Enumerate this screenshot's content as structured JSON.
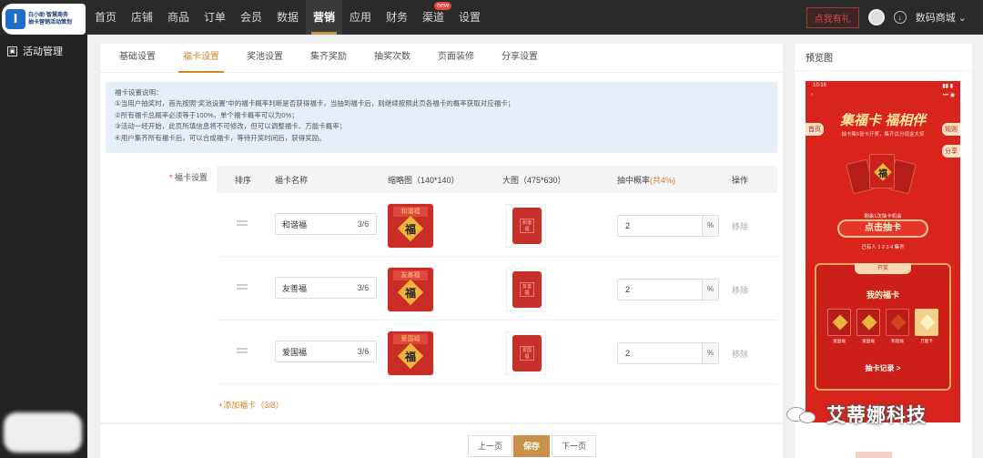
{
  "app": {
    "logo_text_line1": "白小助·智慧商务",
    "logo_text_line2": "抽卡营销活动策划",
    "logo_glyph": "Ⅰ",
    "accent_color": "#c8904a"
  },
  "topnav": {
    "items": [
      {
        "label": "首页"
      },
      {
        "label": "店铺"
      },
      {
        "label": "商品"
      },
      {
        "label": "订单"
      },
      {
        "label": "会员"
      },
      {
        "label": "数据"
      },
      {
        "label": "营销",
        "active": true
      },
      {
        "label": "应用"
      },
      {
        "label": "财务"
      },
      {
        "label": "渠道",
        "badge": "new"
      },
      {
        "label": "设置"
      }
    ],
    "gift_button": "点我有礼",
    "store_name": "数码商城",
    "store_chevron": "⌄",
    "download_glyph": "↓"
  },
  "sidebar": {
    "item_label": "活动管理",
    "item_icon": "▣"
  },
  "tabs": [
    {
      "label": "基础设置"
    },
    {
      "label": "福卡设置",
      "active": true
    },
    {
      "label": "奖池设置"
    },
    {
      "label": "集齐奖励"
    },
    {
      "label": "抽奖次数"
    },
    {
      "label": "页面装修"
    },
    {
      "label": "分享设置"
    }
  ],
  "notice": {
    "lines": [
      "福卡设置说明：",
      "①当用户抽奖时，首先按照“奖池设置”中的福卡概率判断是否获得福卡，当抽到福卡后，则继续按照此页各福卡的概率获取对应福卡；",
      "②所有福卡总概率必须等于100%，单个福卡概率可以为0%；",
      "③活动一经开始，此页所填信息将不可修改，但可以调整福卡、万能卡概率；",
      "④用户集齐所有福卡后，可以合成福卡，等待开奖时间后，获得奖励。"
    ]
  },
  "form": {
    "label_star": "*",
    "label": "福卡设置"
  },
  "table": {
    "headers": {
      "order": "排序",
      "name": "福卡名称",
      "thumb": "缩略图（140*140）",
      "big": "大图（475*630）",
      "prob": "抽中概率",
      "prob_total": "(共4%)",
      "action": "操作"
    },
    "rows": [
      {
        "name": "和谐福",
        "count": "3/6",
        "thumb_title": "和谐福",
        "big_text": "和谐福",
        "prob": "2",
        "unit": "%",
        "remove": "移除"
      },
      {
        "name": "友善福",
        "count": "3/6",
        "thumb_title": "友善福",
        "big_text": "友善福",
        "prob": "2",
        "unit": "%",
        "remove": "移除"
      },
      {
        "name": "爱国福",
        "count": "3/6",
        "thumb_title": "爱国福",
        "big_text": "爱国福",
        "prob": "2",
        "unit": "%",
        "remove": "移除"
      }
    ],
    "fu_char": "福",
    "add_label": "+添加福卡（3/8）"
  },
  "footer": {
    "prev": "上一页",
    "save": "保存",
    "next": "下一页"
  },
  "preview": {
    "title": "预览图",
    "time": "10:16",
    "status_right": "▮▮ ▮",
    "header_left": "‹",
    "header_right": "••• ◉",
    "banner_title": "集福卡 福相伴",
    "banner_sub": "抽卡集5张卡开奖，集齐瓜分现金大奖",
    "side_home": "首页",
    "side_rules": "规则",
    "side_share": "分享",
    "chance_text": "剩余1次抽卡机会",
    "draw_button": "点击抽卡",
    "joined_text": "已有人 1 2 3 4 集齐",
    "open_label": "开奖",
    "my_cards": "我的福卡",
    "mini_labels": [
      "爱国福",
      "爱国福",
      "和谐福",
      "万能卡"
    ],
    "record": "抽卡记录 >",
    "card_char": "福"
  },
  "watermark": {
    "text": "艾蒂娜科技"
  }
}
